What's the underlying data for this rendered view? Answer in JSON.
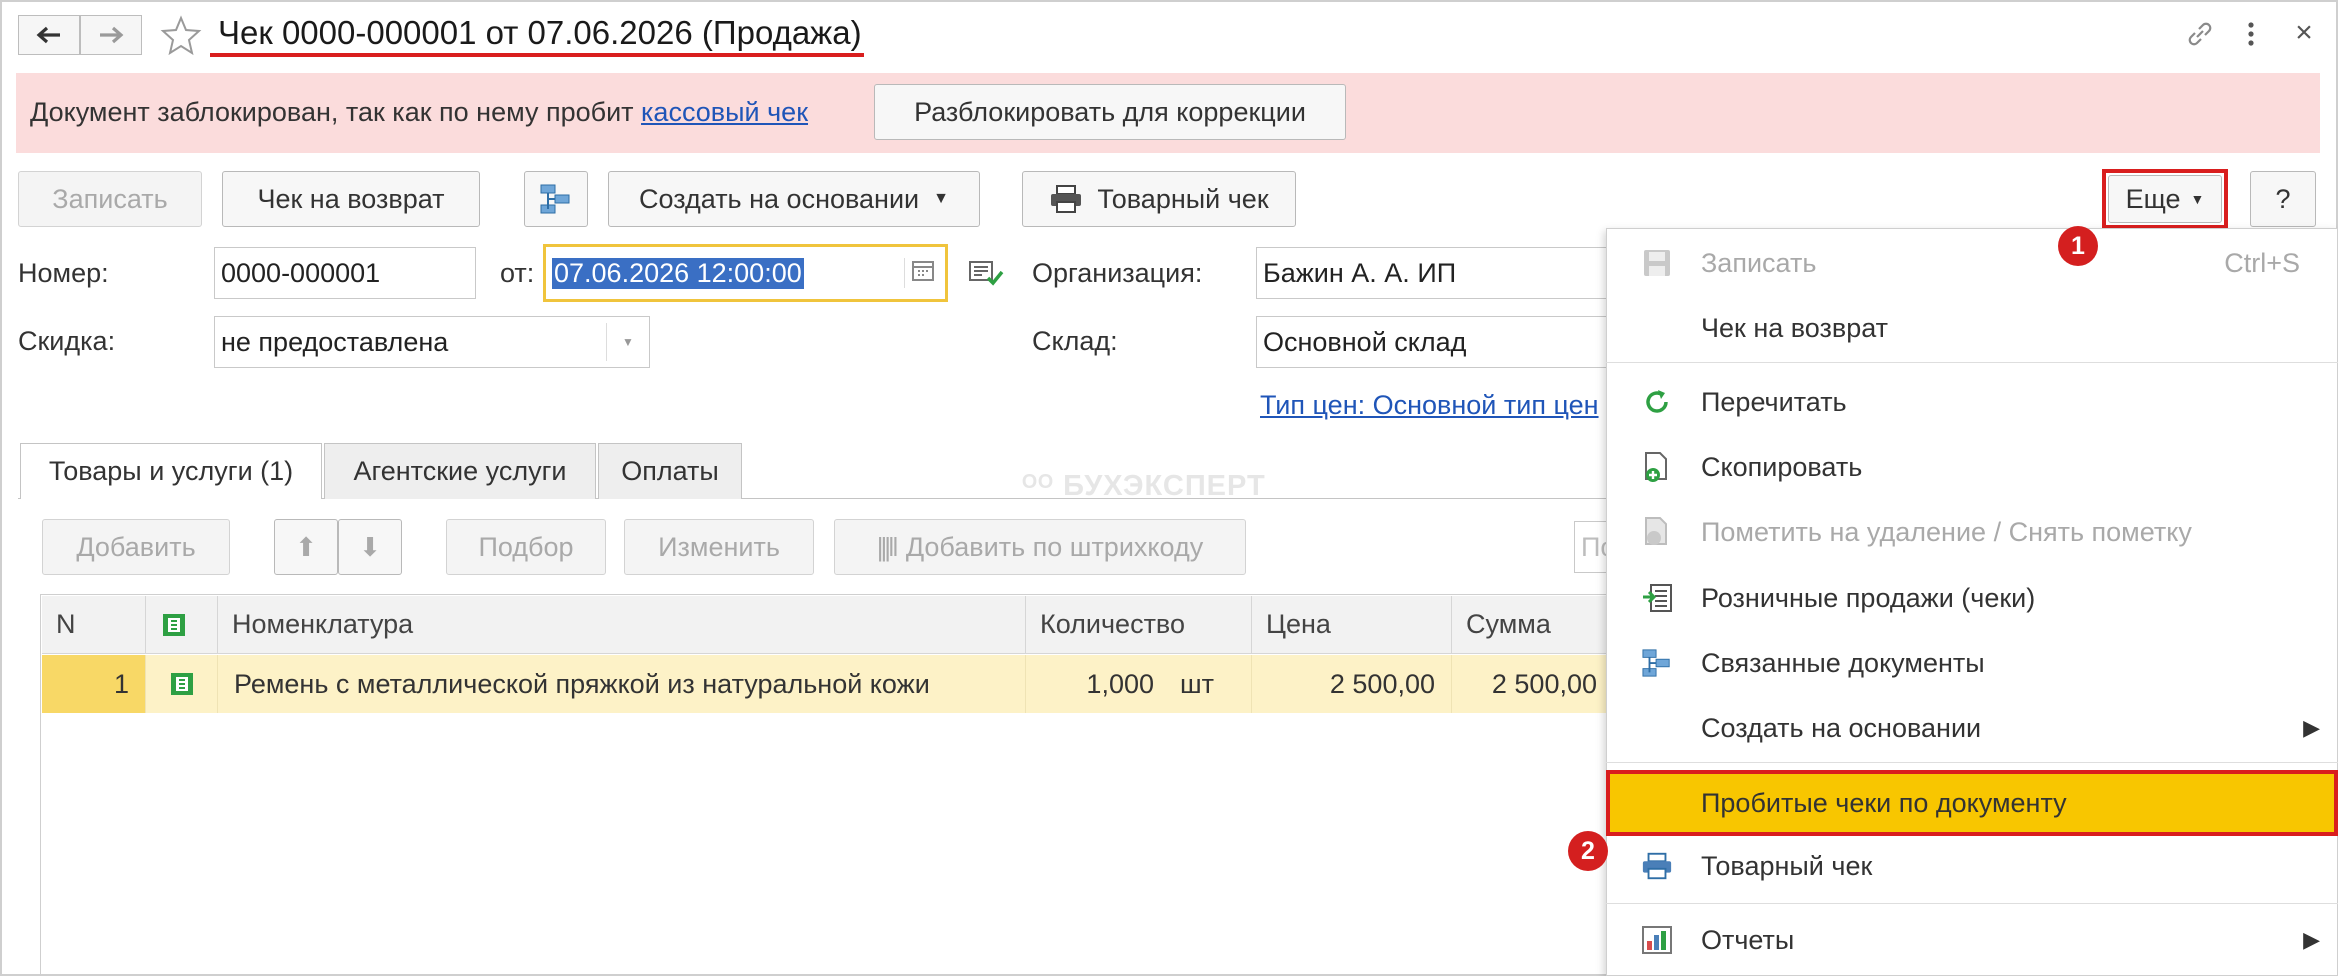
{
  "window": {
    "title": "Чек 0000-000001 от 07.06.2026 (Продажа)",
    "back_icon": "arrow-left-icon",
    "forward_icon": "arrow-right-icon",
    "favorite_icon": "star-icon",
    "link_icon": "link-icon",
    "more_icon": "vertical-dots-icon",
    "close_label": "×"
  },
  "banner": {
    "text": "Документ заблокирован, так как по нему пробит ",
    "link": "кассовый чек",
    "unlock_button": "Разблокировать для коррекции"
  },
  "toolbar": {
    "save": "Записать",
    "return_check": "Чек на возврат",
    "create_based": "Создать на основании",
    "sales_receipt": "Товарный чек",
    "more": "Еще",
    "help": "?"
  },
  "form": {
    "number_label": "Номер:",
    "number_value": "0000-000001",
    "date_label": "от:",
    "date_value": "07.06.2026 12:00:00",
    "discount_label": "Скидка:",
    "discount_value": "не предоставлена",
    "organization_label": "Организация:",
    "organization_value": "Бажин А. А. ИП",
    "warehouse_label": "Склад:",
    "warehouse_value": "Основной склад",
    "price_type_link": "Тип цен: Основной тип цен"
  },
  "tabs": [
    {
      "label": "Товары и услуги (1)",
      "active": true
    },
    {
      "label": "Агентские услуги",
      "active": false
    },
    {
      "label": "Оплаты",
      "active": false
    }
  ],
  "watermark": "БУХЭКСПЕРТ",
  "table_toolbar": {
    "add": "Добавить",
    "select": "Подбор",
    "edit": "Изменить",
    "add_by_barcode": "Добавить по штрихкоду",
    "search_placeholder": "По"
  },
  "table": {
    "columns": [
      "N",
      "Номенклатура",
      "Количество",
      "Цена",
      "Сумма"
    ],
    "rows": [
      {
        "n": "1",
        "item": "Ремень с металлической пряжкой из натуральной кожи",
        "qty": "1,000",
        "unit": "шт",
        "price": "2 500,00",
        "sum": "2 500,00"
      }
    ]
  },
  "menu": {
    "items": [
      {
        "label": "Записать",
        "shortcut": "Ctrl+S",
        "icon": "save-disk-icon",
        "disabled": true
      },
      {
        "label": "Чек на возврат",
        "icon": "",
        "disabled": false
      },
      {
        "label": "Перечитать",
        "icon": "refresh-icon",
        "disabled": false
      },
      {
        "label": "Скопировать",
        "icon": "copy-document-icon",
        "disabled": false
      },
      {
        "label": "Пометить на удаление / Снять пометку",
        "icon": "delete-mark-icon",
        "disabled": true
      },
      {
        "label": "Розничные продажи (чеки)",
        "icon": "retail-sales-icon",
        "disabled": false
      },
      {
        "label": "Связанные документы",
        "icon": "related-documents-icon",
        "disabled": false
      },
      {
        "label": "Создать на основании",
        "icon": "",
        "submenu": true
      },
      {
        "label": "Пробитые чеки по документу",
        "icon": "",
        "highlighted": true
      },
      {
        "label": "Товарный чек",
        "icon": "printer-icon",
        "disabled": false
      },
      {
        "label": "Отчеты",
        "icon": "reports-icon",
        "submenu": true
      }
    ]
  },
  "markers": [
    "1",
    "2"
  ],
  "colors": {
    "banner_bg": "#fbdcdc",
    "highlight": "#f8c600",
    "annotation_red": "#d91e1e",
    "date_field_border": "#f0c43c",
    "link_blue": "#1f55b8"
  }
}
